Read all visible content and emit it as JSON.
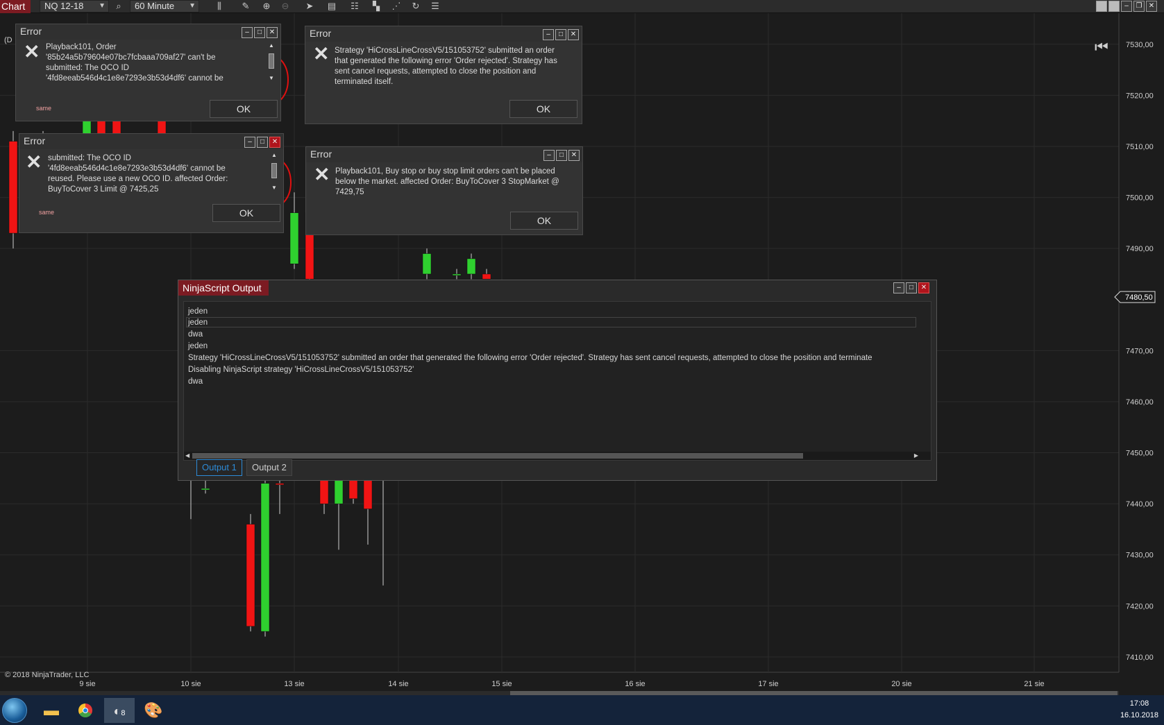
{
  "toolbar": {
    "title": "Chart",
    "instrument": "NQ 12-18",
    "timeframe": "60 Minute",
    "icons": [
      "search-icon",
      "bars-icon",
      "pencil-icon",
      "zoom-in-icon",
      "zoom-out-icon",
      "pointer-icon",
      "properties-icon",
      "strategies-icon",
      "templates-icon",
      "indicators-icon",
      "reload-icon",
      "menu-icon"
    ],
    "window_buttons": [
      "tile-icon",
      "tile-icon",
      "minimize-icon",
      "restore-icon",
      "close-icon"
    ]
  },
  "chart": {
    "corner_label": "(D",
    "copyright": "© 2018 NinjaTrader, LLC",
    "current_price": "7480,50",
    "price_labels": [
      "7530,00",
      "7520,00",
      "7510,00",
      "7500,00",
      "7490,00",
      "7480,50",
      "7470,00",
      "7460,00",
      "7450,00",
      "7440,00",
      "7430,00",
      "7420,00",
      "7410,00"
    ],
    "date_labels": [
      "9 sie",
      "10 sie",
      "13 sie",
      "14 sie",
      "15 sie",
      "16 sie",
      "17 sie",
      "20 sie",
      "21 sie"
    ],
    "colors": {
      "background": "#1c1c1c",
      "up": "#2fd02f",
      "down": "#f11414",
      "grid": "#2b2b2b"
    }
  },
  "chart_data": {
    "type": "candlestick",
    "x_labels": [
      "9 sie",
      "10 sie",
      "13 sie",
      "14 sie",
      "15 sie",
      "16 sie",
      "17 sie",
      "20 sie",
      "21 sie"
    ],
    "ylim": [
      7407,
      7535
    ],
    "current_price": 7480.5,
    "candles": [
      {
        "open": 7511,
        "close": 7493,
        "high": 7513,
        "low": 7490,
        "dir": "down"
      },
      {
        "open": 7510,
        "close": 7511,
        "high": 7513,
        "low": 7510,
        "dir": "up"
      },
      {
        "open": 7510,
        "close": 7515,
        "high": 7517,
        "low": 7509,
        "dir": "up"
      },
      {
        "open": 7515,
        "close": 7510,
        "high": 7517,
        "low": 7509,
        "dir": "down"
      },
      {
        "open": 7515,
        "close": 7510,
        "high": 7516,
        "low": 7509,
        "dir": "down"
      },
      {
        "open": 7516,
        "close": 7510,
        "high": 7517,
        "low": 7509,
        "dir": "down"
      },
      {
        "open": 7449,
        "close": 7451,
        "high": 7453,
        "low": 7437,
        "dir": "up"
      },
      {
        "open": 7443,
        "close": 7443,
        "high": 7447,
        "low": 7442,
        "dir": "up"
      },
      {
        "open": 7436,
        "close": 7416,
        "high": 7438,
        "low": 7415,
        "dir": "down"
      },
      {
        "open": 7415,
        "close": 7444,
        "high": 7446,
        "low": 7414,
        "dir": "up"
      },
      {
        "open": 7444,
        "close": 7444,
        "high": 7448,
        "low": 7438,
        "dir": "down"
      },
      {
        "open": 7487,
        "close": 7497,
        "high": 7501,
        "low": 7486,
        "dir": "up"
      },
      {
        "open": 7497,
        "close": 7484,
        "high": 7500,
        "low": 7482,
        "dir": "down"
      },
      {
        "open": 7446,
        "close": 7440,
        "high": 7448,
        "low": 7438,
        "dir": "down"
      },
      {
        "open": 7440,
        "close": 7446,
        "high": 7448,
        "low": 7431,
        "dir": "up"
      },
      {
        "open": 7445,
        "close": 7441,
        "high": 7447,
        "low": 7440,
        "dir": "down"
      },
      {
        "open": 7446,
        "close": 7439,
        "high": 7448,
        "low": 7432,
        "dir": "down"
      },
      {
        "open": 7446,
        "close": 7446,
        "high": 7448,
        "low": 7424,
        "dir": "up"
      },
      {
        "open": 7485,
        "close": 7489,
        "high": 7490,
        "low": 7484,
        "dir": "up"
      },
      {
        "open": 7485,
        "close": 7485,
        "high": 7486,
        "low": 7484,
        "dir": "up"
      },
      {
        "open": 7485,
        "close": 7488,
        "high": 7489,
        "low": 7484,
        "dir": "up"
      },
      {
        "open": 7485,
        "close": 7484,
        "high": 7486,
        "low": 7484,
        "dir": "down"
      }
    ]
  },
  "dialogs": [
    {
      "title": "Error",
      "icon": "error-x-icon",
      "message_lines": [
        "Playback101, Order",
        "'85b24a5b79604e07bc7fcbaaa709af27' can't be",
        "submitted: The OCO ID",
        "'4fd8eeab546d4c1e8e7293e3b53d4df6' cannot be"
      ],
      "ok": "OK",
      "hint": "same"
    },
    {
      "title": "Error",
      "icon": "error-x-icon",
      "message_lines": [
        "submitted: The OCO ID",
        "'4fd8eeab546d4c1e8e7293e3b53d4df6' cannot be",
        "reused. Please use a new OCO ID. affected Order:",
        "BuyToCover 3 Limit @ 7425,25"
      ],
      "ok": "OK",
      "hint": "same"
    },
    {
      "title": "Error",
      "icon": "error-x-icon",
      "message_lines": [
        "Strategy 'HiCrossLineCrossV5/151053752' submitted an order",
        "that generated the following error 'Order rejected'. Strategy has",
        "sent cancel requests, attempted to close the position and",
        "terminated itself."
      ],
      "ok": "OK"
    },
    {
      "title": "Error",
      "icon": "error-x-icon",
      "message_lines": [
        "Playback101, Buy stop or buy stop limit orders can't be placed",
        "below the market. affected Order: BuyToCover 3 StopMarket @",
        "7429,75"
      ],
      "ok": "OK"
    }
  ],
  "output": {
    "title": "NinjaScript Output",
    "lines": [
      "jeden",
      "jeden",
      "dwa",
      "jeden",
      "Strategy 'HiCrossLineCrossV5/151053752' submitted an order that generated the following error 'Order rejected'. Strategy has sent cancel requests, attempted to close the position and terminate",
      "Disabling NinjaScript strategy 'HiCrossLineCrossV5/151053752'",
      "dwa"
    ],
    "tabs": [
      "Output 1",
      "Output 2"
    ],
    "active_tab": "Output 1"
  },
  "taskbar": {
    "apps": [
      "start-orb-icon",
      "folder-icon",
      "chrome-icon",
      "ninjatrader-icon",
      "paint-icon"
    ],
    "ninja_badge": "8",
    "time": "17:08",
    "date": "16.10.2018"
  }
}
